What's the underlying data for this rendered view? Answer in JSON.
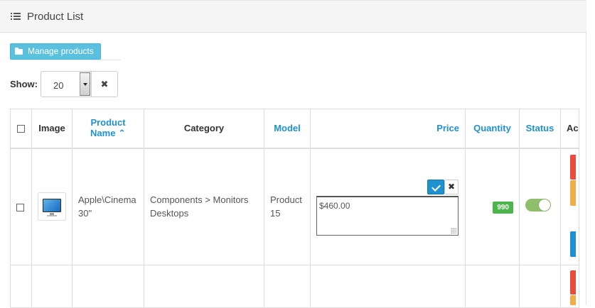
{
  "panel": {
    "title": "Product List",
    "icon": "list-icon"
  },
  "toolbar": {
    "manage_label": "Manage products",
    "manage_icon": "folder-icon"
  },
  "filter": {
    "show_label": "Show:",
    "show_value": "20",
    "reset_label": "✖"
  },
  "table": {
    "headers": {
      "image": "Image",
      "name": "Product Name",
      "name_sort_icon": "⌃",
      "category": "Category",
      "model": "Model",
      "price": "Price",
      "quantity": "Quantity",
      "status": "Status",
      "action": "Ac"
    },
    "rows": [
      {
        "name": "Apple\\Cinema 30\"",
        "category": "Components > Monitors Desktops",
        "model": "Product 15",
        "price": "$460.00",
        "quantity": "990",
        "status_enabled": true
      }
    ]
  },
  "colors": {
    "accent": "#1e91cf",
    "info": "#5bc0de",
    "success": "#4cb64c",
    "danger": "#e74c3c",
    "warning": "#f0ad4e"
  }
}
